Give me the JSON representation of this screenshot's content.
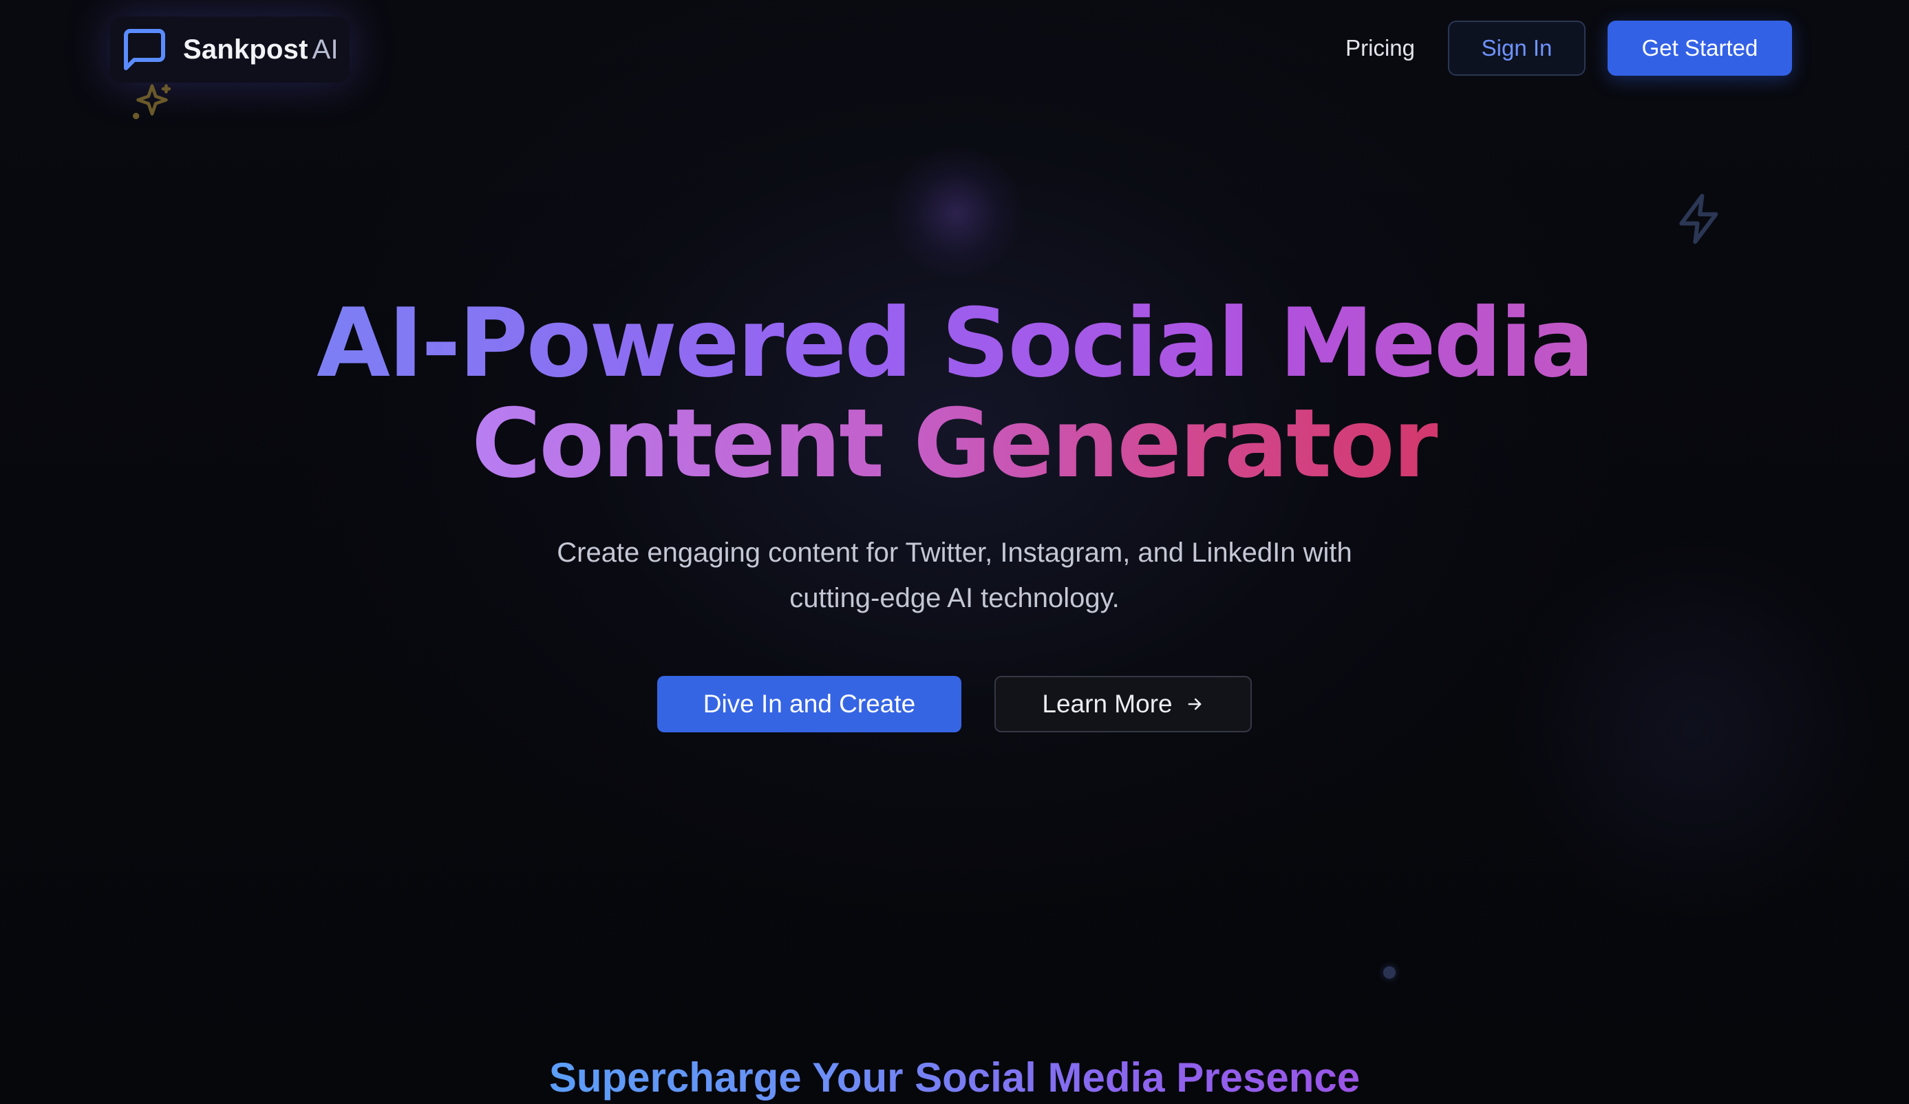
{
  "brand": {
    "name": "Sankpost",
    "suffix": "AI",
    "icon": "chat-bubble-icon"
  },
  "nav": {
    "pricing": "Pricing",
    "sign_in": "Sign In",
    "get_started": "Get Started"
  },
  "decorations": {
    "sparkle": "sparkle-icon",
    "bolt": "lightning-bolt-icon"
  },
  "hero": {
    "title_line1": "AI-Powered Social Media",
    "title_line2": "Content Generator",
    "subtitle_line1": "Create engaging content for Twitter, Instagram, and LinkedIn with",
    "subtitle_line2": "cutting-edge AI technology.",
    "primary_button": "Dive In and Create",
    "secondary_button": "Learn More",
    "secondary_icon": "arrow-right-icon"
  },
  "section": {
    "title": "Supercharge Your Social Media Presence"
  },
  "colors": {
    "accent": "#3361e6",
    "sign_in_text": "#6f93ff",
    "background": "#07080c"
  }
}
